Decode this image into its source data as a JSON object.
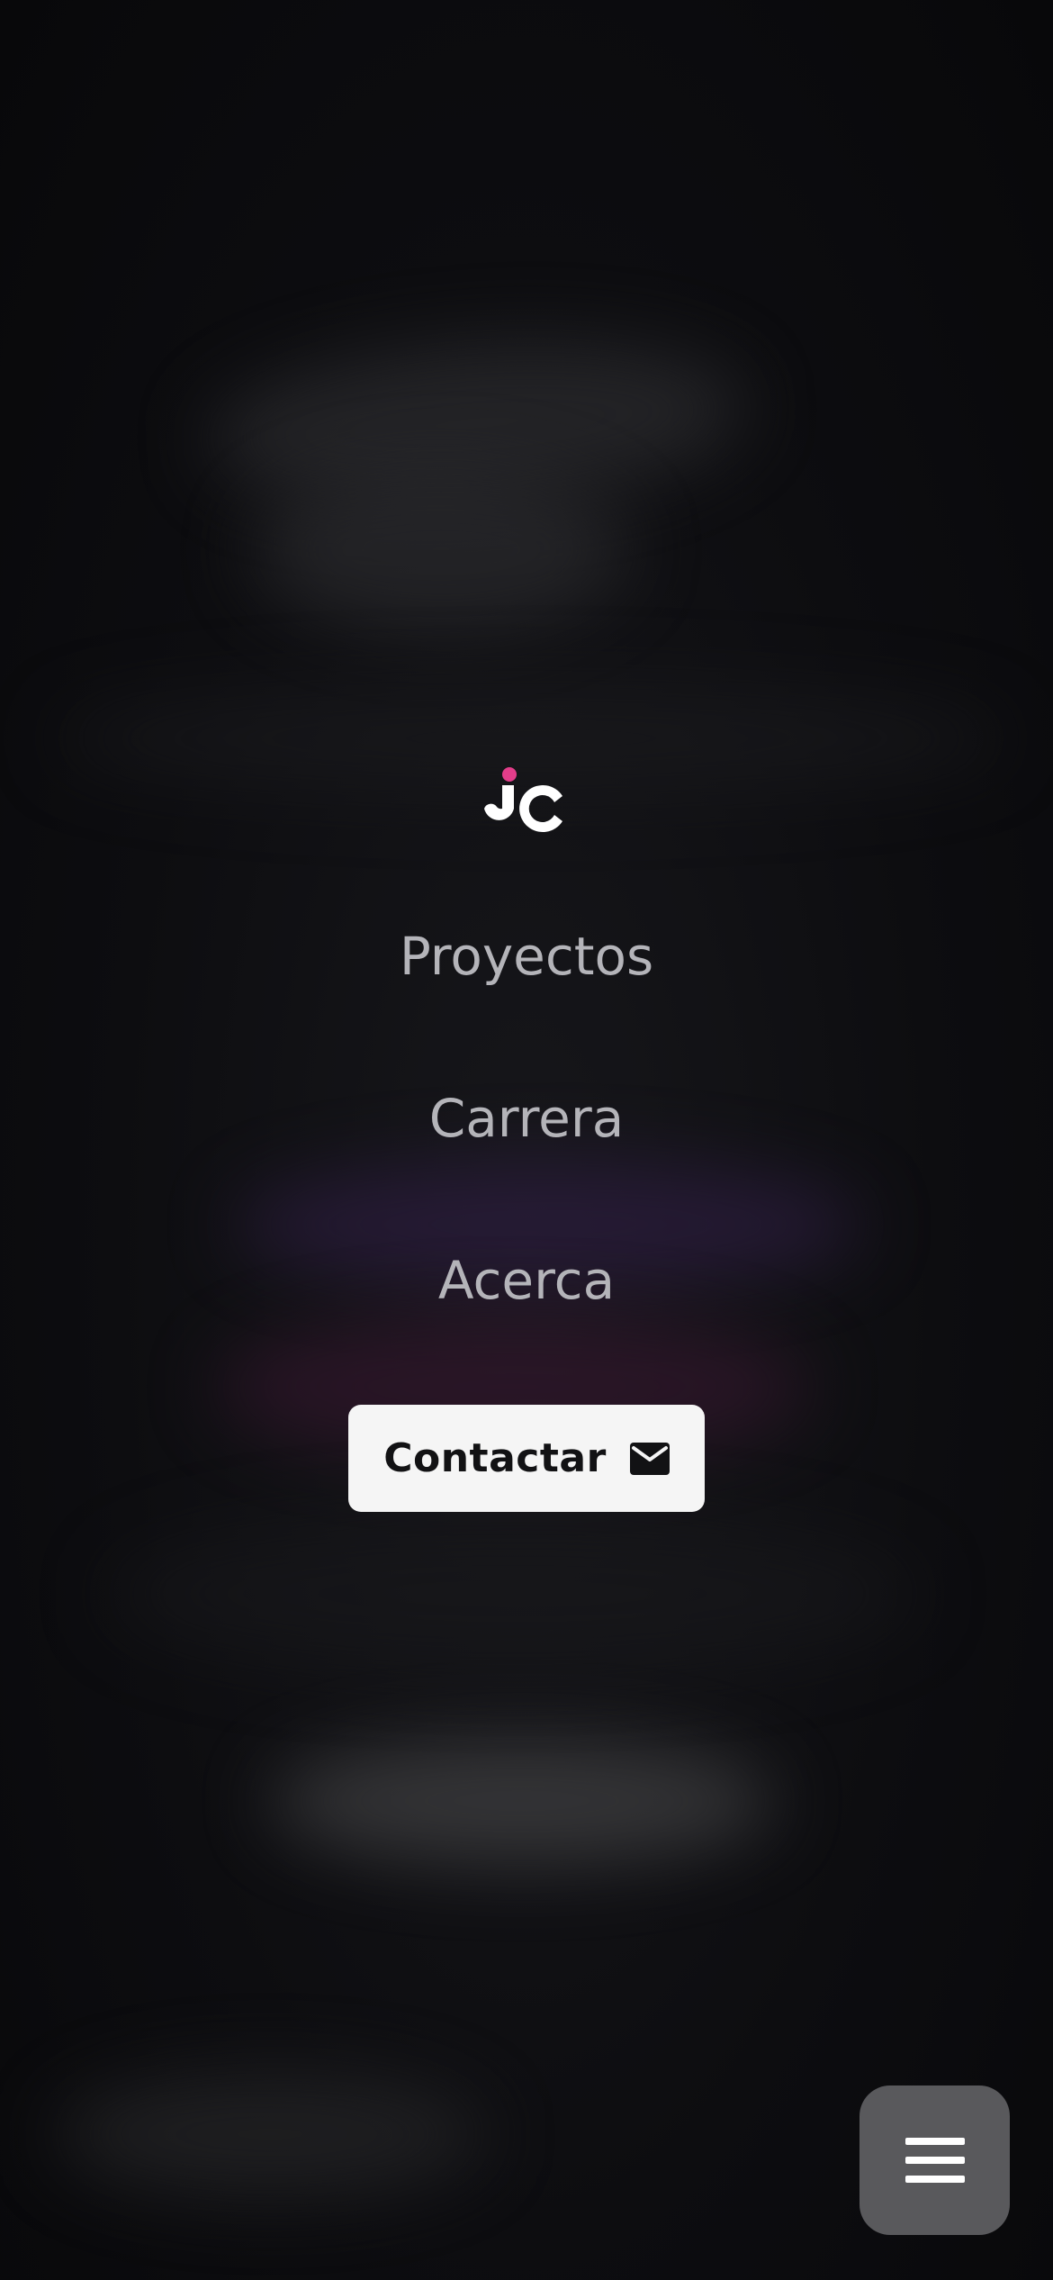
{
  "menu": {
    "links": [
      {
        "label": "Proyectos"
      },
      {
        "label": "Carrera"
      },
      {
        "label": "Acerca"
      }
    ],
    "contact_label": "Contactar",
    "contact_icon": "mail-icon"
  },
  "logo": {
    "icon": "jc-logo",
    "accent_color": "#e33d8a"
  },
  "fab": {
    "icon": "hamburger-menu-icon"
  },
  "colors": {
    "background": "#0b0b0e",
    "link_text": "#b4b4b9",
    "button_bg": "#f5f5f5",
    "button_text": "#121214",
    "fab_bg": "#59595c"
  }
}
